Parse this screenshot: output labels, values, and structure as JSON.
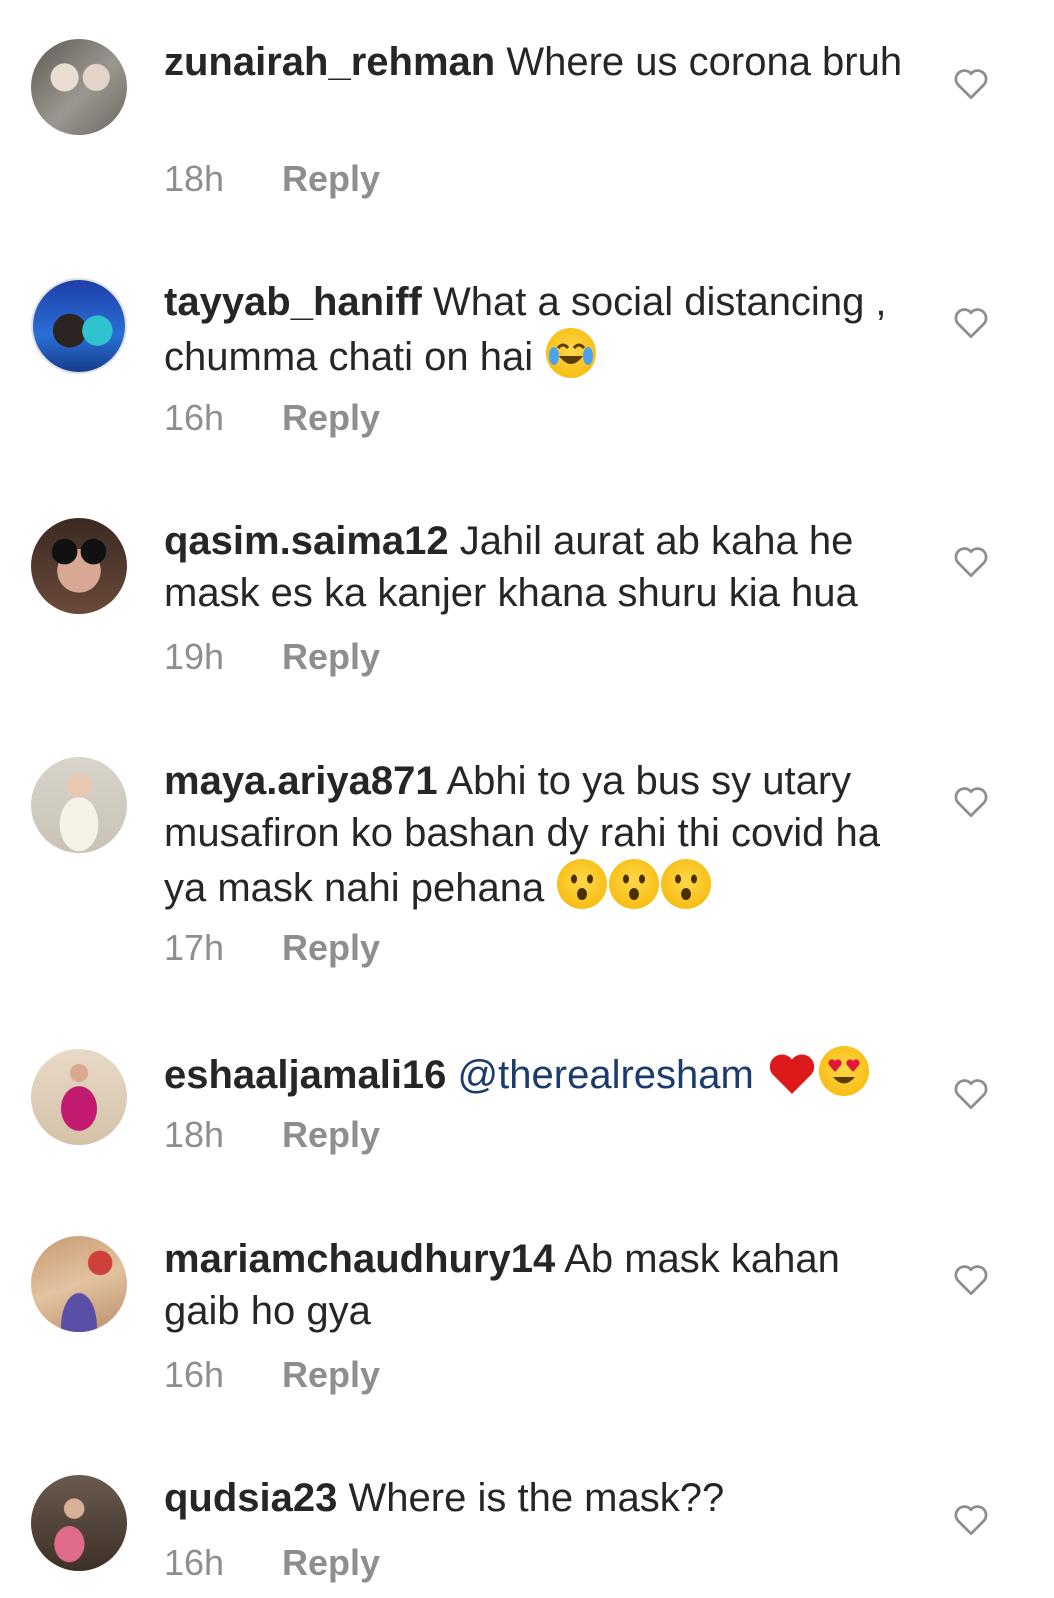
{
  "comments": [
    {
      "username": "zunairah_rehman",
      "text": "Where us corona bruh",
      "time": "18h",
      "reply": "Reply"
    },
    {
      "username": "tayyab_haniff",
      "text": "What a social distancing , chumma chati on hai",
      "time": "16h",
      "reply": "Reply",
      "emojis": [
        "face-with-tears-of-joy"
      ]
    },
    {
      "username": "qasim.saima12",
      "text": "Jahil aurat ab kaha he mask es ka kanjer khana shuru kia hua",
      "time": "19h",
      "reply": "Reply"
    },
    {
      "username": "maya.ariya871",
      "text": "Abhi to ya bus sy utary musafiron ko bashan dy rahi thi covid ha ya mask nahi pehana",
      "time": "17h",
      "reply": "Reply",
      "emojis": [
        "hushed-face",
        "hushed-face",
        "hushed-face"
      ]
    },
    {
      "username": "eshaaljamali16",
      "mention": "@therealresham",
      "time": "18h",
      "reply": "Reply",
      "emojis": [
        "red-heart",
        "smiling-face-with-heart-eyes"
      ]
    },
    {
      "username": "mariamchaudhury14",
      "text": "Ab mask kahan gaib ho gya",
      "time": "16h",
      "reply": "Reply"
    },
    {
      "username": "qudsia23",
      "text": "Where is the mask??",
      "time": "16h",
      "reply": "Reply"
    }
  ],
  "colors": {
    "text": "#262626",
    "meta": "#8e8e8e",
    "mention": "#1b3b6e",
    "heart_outline": "#8e8e8e"
  },
  "icons": {
    "like": "heart-outline-icon"
  }
}
